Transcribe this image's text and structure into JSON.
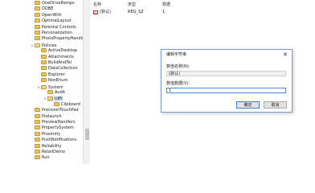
{
  "tree": {
    "items": [
      {
        "label": "OneDriveRamps",
        "depth": 0,
        "expanded": false,
        "selected": false
      },
      {
        "label": "OOBE",
        "depth": 0,
        "expanded": false,
        "selected": false
      },
      {
        "label": "OpenWith",
        "depth": 0,
        "expanded": false,
        "selected": false
      },
      {
        "label": "OptimalLayout",
        "depth": 0,
        "expanded": false,
        "selected": false
      },
      {
        "label": "Parental Controls",
        "depth": 0,
        "expanded": false,
        "selected": false
      },
      {
        "label": "Personalization",
        "depth": 0,
        "expanded": false,
        "selected": false
      },
      {
        "label": "PhotoPropertyHandle",
        "depth": 0,
        "expanded": false,
        "selected": false
      },
      {
        "label": "Policies",
        "depth": 0,
        "expanded": true,
        "selected": false
      },
      {
        "label": "ActiveDesktop",
        "depth": 1,
        "expanded": false,
        "selected": false
      },
      {
        "label": "Attachments",
        "depth": 1,
        "expanded": false,
        "selected": false
      },
      {
        "label": "BuildAndTel",
        "depth": 1,
        "expanded": false,
        "selected": false
      },
      {
        "label": "DataCollection",
        "depth": 1,
        "expanded": false,
        "selected": false
      },
      {
        "label": "Explorer",
        "depth": 1,
        "expanded": false,
        "selected": false
      },
      {
        "label": "NonEnum",
        "depth": 1,
        "expanded": false,
        "selected": false
      },
      {
        "label": "System",
        "depth": 1,
        "expanded": true,
        "selected": false
      },
      {
        "label": "Audit",
        "depth": 2,
        "expanded": false,
        "selected": false
      },
      {
        "label": "UIPI",
        "depth": 2,
        "expanded": true,
        "selected": true
      },
      {
        "label": "Clipboard",
        "depth": 3,
        "expanded": false,
        "selected": false
      },
      {
        "label": "PrecisionTouchPad",
        "depth": 0,
        "expanded": false,
        "selected": false
      },
      {
        "label": "Prelaunch",
        "depth": 0,
        "expanded": false,
        "selected": false
      },
      {
        "label": "PreviewHandlers",
        "depth": 0,
        "expanded": false,
        "selected": false
      },
      {
        "label": "PropertySystem",
        "depth": 0,
        "expanded": false,
        "selected": false
      },
      {
        "label": "Proximity",
        "depth": 0,
        "expanded": false,
        "selected": false
      },
      {
        "label": "PushNotifications",
        "depth": 0,
        "expanded": false,
        "selected": false
      },
      {
        "label": "Reliability",
        "depth": 0,
        "expanded": false,
        "selected": false
      },
      {
        "label": "RetailDemo",
        "depth": 0,
        "expanded": false,
        "selected": false
      },
      {
        "label": "Run",
        "depth": 0,
        "expanded": false,
        "selected": false
      }
    ]
  },
  "list": {
    "headers": {
      "name": "名称",
      "type": "类型",
      "data": "数据"
    },
    "rows": [
      {
        "icon": "string-value-icon",
        "name": "(默认)",
        "type": "REG_SZ",
        "data": "1"
      }
    ]
  },
  "dialog": {
    "title": "编辑字符串",
    "close_glyph": "✕",
    "value_name_label": "数值名称(N):",
    "value_name": "(默认)",
    "value_data_label": "数值数据(V):",
    "value_data": "1",
    "ok_label": "确定",
    "cancel_label": "取消"
  },
  "colors": {
    "folder": "#e8c35a",
    "selection": "#cce4f7",
    "dialog_border": "#7a9ecf",
    "primary_button_border": "#3c7fd6"
  }
}
